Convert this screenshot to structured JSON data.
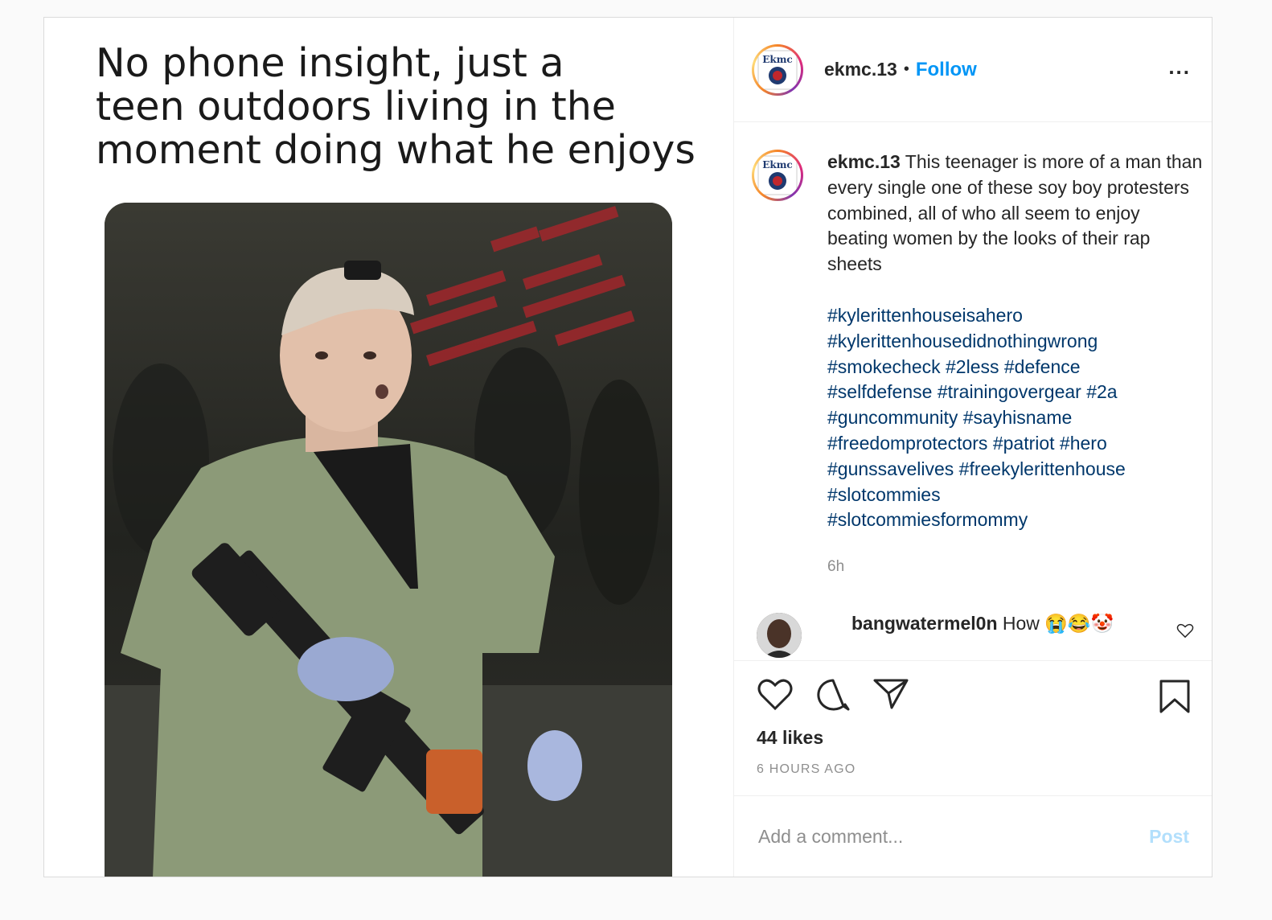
{
  "media": {
    "meme_caption": "No phone insight, just a\nteen outdoors living in the\nmoment doing what he enjoys"
  },
  "header": {
    "username": "ekmc.13",
    "separator": "•",
    "follow_label": "Follow",
    "more_label": "...",
    "avatar_text": "Ekmc"
  },
  "caption": {
    "username": "ekmc.13",
    "text": "This teenager is more of a man than every single one of these soy boy protesters combined, all of who all seem to enjoy beating women by the looks of their rap sheets",
    "hashtag_lines": [
      "#kylerittenhouseisahero",
      "#kylerittenhousedidnothingwrong",
      "#smokecheck #2less #defence",
      "#selfdefense #trainingovergear #2a",
      "#guncommunity #sayhisname",
      "#freedomprotectors #patriot #hero",
      "#gunssavelives #freekylerittenhouse",
      "#slotcommies",
      "#slotcommiesformommy"
    ],
    "time": "6h"
  },
  "comment": {
    "username": "bangwatermel0n",
    "text": "How 😭😂🤡"
  },
  "actions": {
    "likes": "44 likes",
    "time_ago": "6 HOURS AGO"
  },
  "add_comment": {
    "placeholder": "Add a comment...",
    "post_label": "Post"
  },
  "colors": {
    "link": "#0095f6",
    "hashtag": "#00376b",
    "muted": "#8e8e8e",
    "post_disabled": "#b2dffc"
  }
}
